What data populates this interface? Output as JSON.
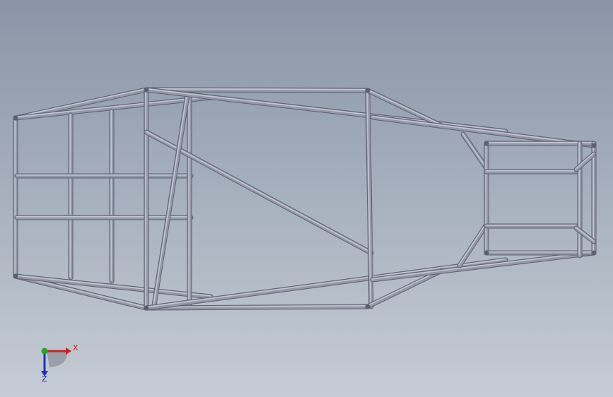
{
  "viewport": {
    "background_top": "#8995a6",
    "background_bottom": "#c5ccd5",
    "tube_color": "#9598a8",
    "tube_dark": "#5d6070",
    "tube_light": "#c3c6d2"
  },
  "triad": {
    "x_label": "X",
    "z_label": "Z",
    "x_color": "#cc2020",
    "y_color": "#22aa22",
    "z_color": "#2030c0"
  }
}
